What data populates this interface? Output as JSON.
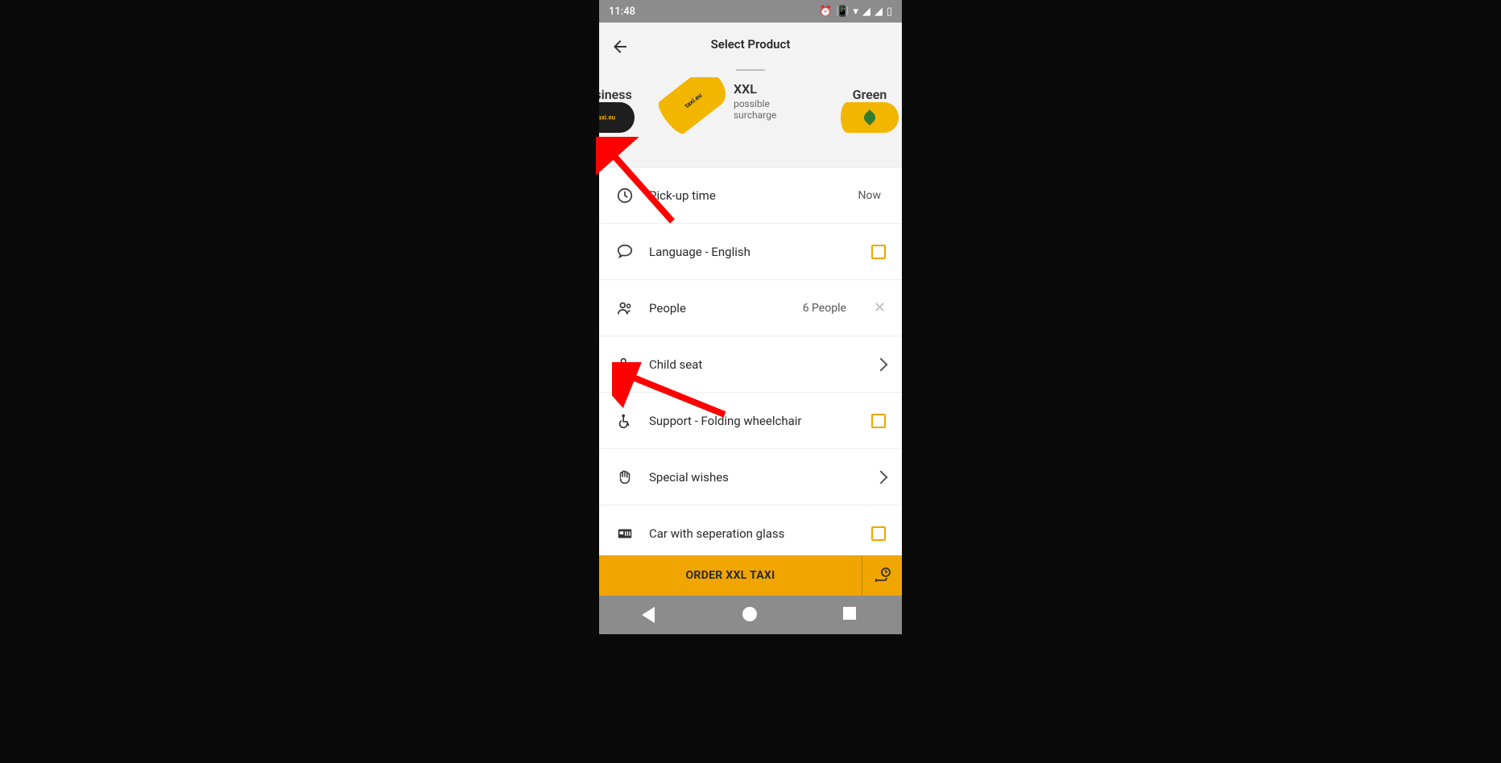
{
  "statusbar": {
    "time": "11:48"
  },
  "header": {
    "title": "Select Product"
  },
  "products": {
    "left": {
      "label": "Business"
    },
    "center": {
      "label": "XXL",
      "sub": "possible surcharge",
      "brand": "taxi.eu"
    },
    "right": {
      "label": "Green"
    }
  },
  "brand": "taxi.eu",
  "rows": {
    "pickup": {
      "label": "Pick-up time",
      "value": "Now"
    },
    "language": {
      "label": "Language - English"
    },
    "people": {
      "label": "People",
      "value": "6 People"
    },
    "childseat": {
      "label": "Child seat"
    },
    "support": {
      "label": "Support - Folding wheelchair"
    },
    "wishes": {
      "label": "Special wishes"
    },
    "separation": {
      "label": "Car with seperation glass"
    }
  },
  "order": {
    "button": "ORDER XXL TAXI"
  }
}
